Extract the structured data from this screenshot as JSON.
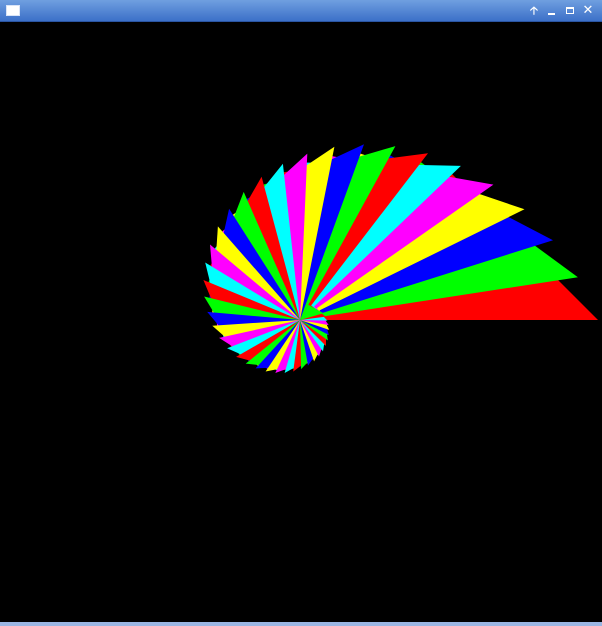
{
  "window": {
    "title": "",
    "icons": {
      "app": "window-app-icon",
      "up": "arrow-up-icon",
      "minimize": "minimize-icon",
      "maximize": "maximize-icon",
      "close": "close-icon"
    },
    "glyphs": {
      "up": "🡡",
      "close": "✕"
    },
    "titlebar_color": "#4f84d6"
  },
  "drawing": {
    "background": "#000000",
    "palette": [
      "#ff0000",
      "#00ff00",
      "#0000ff",
      "#ffff00",
      "#ff00ff",
      "#00ffff"
    ]
  }
}
